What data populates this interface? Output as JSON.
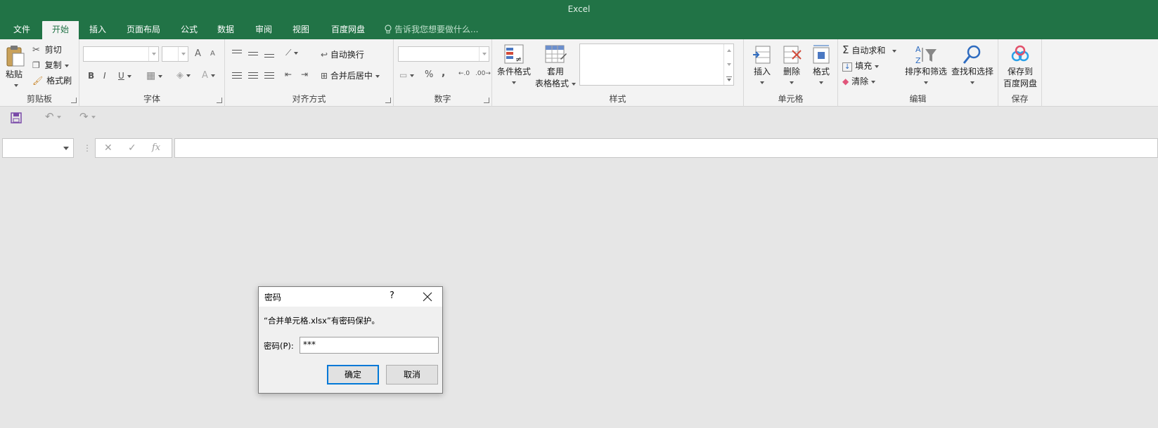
{
  "app": {
    "title": "Excel"
  },
  "tabs": [
    {
      "label": "文件"
    },
    {
      "label": "开始"
    },
    {
      "label": "插入"
    },
    {
      "label": "页面布局"
    },
    {
      "label": "公式"
    },
    {
      "label": "数据"
    },
    {
      "label": "审阅"
    },
    {
      "label": "视图"
    },
    {
      "label": "百度网盘"
    }
  ],
  "active_tab": "开始",
  "tell_me": "告诉我您想要做什么...",
  "ribbon": {
    "clipboard": {
      "paste": "粘贴",
      "cut": "剪切",
      "copy": "复制",
      "format_painter": "格式刷",
      "group": "剪贴板"
    },
    "font": {
      "group": "字体",
      "bold": "B",
      "italic": "I",
      "underline": "U",
      "font_color": "A",
      "grow": "A",
      "shrink": "A"
    },
    "alignment": {
      "wrap_text": "自动换行",
      "merge_center": "合并后居中",
      "group": "对齐方式"
    },
    "number": {
      "percent": "%",
      "comma": ",",
      "group": "数字"
    },
    "styles": {
      "conditional": "条件格式",
      "table_format_line1": "套用",
      "table_format_line2": "表格格式",
      "group": "样式"
    },
    "cells": {
      "insert": "插入",
      "delete": "删除",
      "format": "格式",
      "group": "单元格"
    },
    "editing": {
      "autosum": "自动求和",
      "fill": "填充",
      "clear": "清除",
      "sort_filter": "排序和筛选",
      "find_select": "查找和选择",
      "group": "编辑"
    },
    "save": {
      "line1": "保存到",
      "line2": "百度网盘",
      "group": "保存"
    }
  },
  "formula_bar": {
    "fx": "fx"
  },
  "dialog": {
    "title": "密码",
    "help": "?",
    "message": "“合并单元格.xlsx”有密码保护。",
    "password_label": "密码(P):",
    "password_value": "***",
    "ok": "确定",
    "cancel": "取消"
  },
  "colors": {
    "brand": "#217346",
    "accent_focus": "#0078d7"
  }
}
